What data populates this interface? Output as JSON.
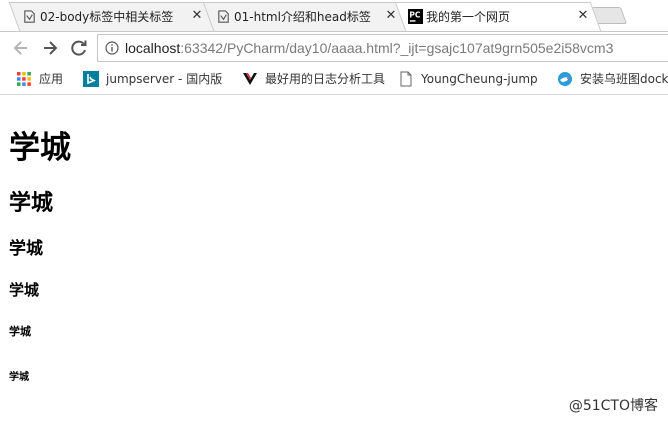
{
  "tabs": [
    {
      "title": "02-body标签中相关标签",
      "active": false,
      "favicon": "pycharm-doc-icon"
    },
    {
      "title": "01-html介绍和head标签",
      "active": false,
      "favicon": "pycharm-doc-icon"
    },
    {
      "title": "我的第一个网页",
      "active": true,
      "favicon": "pycharm-icon"
    }
  ],
  "close_glyph": "✕",
  "toolbar": {
    "url_host": "localhost",
    "url_rest": ":63342/PyCharm/day10/aaaa.html?_ijt=gsajc107at9grn505e2i58vcm3"
  },
  "bookmarks": [
    {
      "label": "应用",
      "icon": "apps-grid-icon"
    },
    {
      "label": "jumpserver - 国内版",
      "icon": "bing-icon"
    },
    {
      "label": "最好用的日志分析工具",
      "icon": "v-logo-icon"
    },
    {
      "label": "YoungCheung-jump",
      "icon": "page-icon"
    },
    {
      "label": "安装乌班图docker",
      "icon": "bird-icon"
    }
  ],
  "headings": {
    "h1": "学城",
    "h2": "学城",
    "h3": "学城",
    "h4": "学城",
    "h5": "学城",
    "h6": "学城"
  },
  "watermark": "@51CTO博客",
  "colors": {
    "accent": "#1a73e8",
    "border": "#c9c9c9"
  }
}
